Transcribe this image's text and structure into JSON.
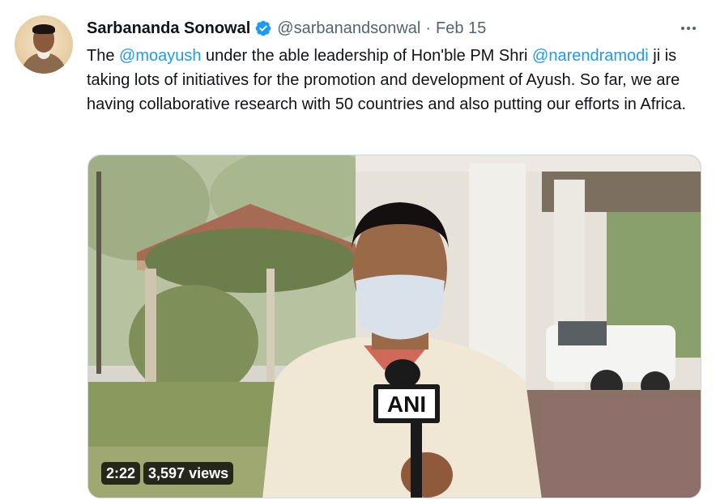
{
  "tweet": {
    "author_name": "Sarbananda Sonowal",
    "handle": "@sarbanandsonwal",
    "separator": "·",
    "date": "Feb 15",
    "verified": true,
    "text": {
      "p1": "The ",
      "mention1": "@moayush",
      "p2": " under the able leadership of Hon'ble PM Shri ",
      "mention2": "@narendramodi",
      "p3": " ji is taking lots of initiatives for the promotion and development of Ayush. So far, we are having collaborative research with 50 countries and also putting our efforts in Africa."
    }
  },
  "media": {
    "type": "video",
    "duration": "2:22",
    "views": "3,597 views",
    "mic_label": "ANI"
  },
  "icons": {
    "verified": "verified-badge-icon",
    "more": "more-options-icon"
  },
  "colors": {
    "link": "#1d9bf0",
    "secondary_text": "#536471",
    "verified": "#1d9bf0"
  }
}
